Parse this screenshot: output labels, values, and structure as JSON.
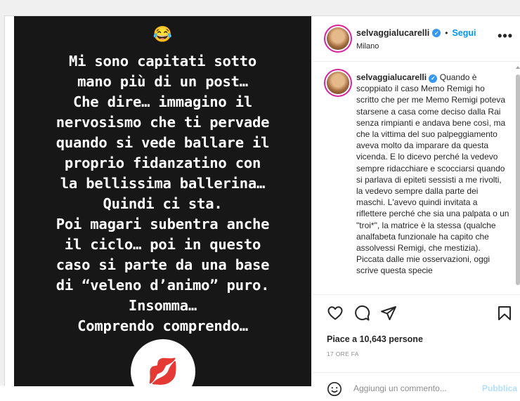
{
  "post": {
    "story": {
      "top_emoji": "😂",
      "lines": [
        "Mi sono capitati sotto",
        "mano più di un post…",
        "Che dire… immagino il",
        "nervosismo che ti pervade",
        "quando si vede ballare il",
        "proprio fidanzatino con",
        "la bellissima ballerina…",
        "Quindi ci sta.",
        "Poi magari subentra anche",
        "il ciclo… poi in questo",
        "caso si parte da una base",
        "di “veleno d’animo” puro.",
        "Insomma…",
        "Comprendo comprendo…"
      ],
      "sticker_emoji": "💋"
    },
    "header": {
      "username": "selvaggialucarelli",
      "verified_icon": "verified-badge-icon",
      "separator": "•",
      "follow_label": "Segui",
      "location": "Milano",
      "more_label": "•••"
    },
    "caption": {
      "username": "selvaggialucarelli",
      "text": "Quando è scoppiato il caso Memo Remigi ho scritto che per me Memo Remigi poteva starsene a casa come deciso dalla Rai senza rimpianti e andava bene così, ma che la vittima del suo palpeggiamento aveva molto da imparare da questa vicenda. E lo dicevo perché la vedevo sempre ridacchiare e scocciarsi quando si parlava di epiteti sessisti a me rivolti, la vedevo sempre dalla parte dei maschi. L'avevo quindi invitata a riflettere perché che sia una palpata o un \"troi*\", la matrice è la stessa (qualche analfabeta funzionale ha capito che assolvessi Remigi, che mestizia). Piccata dalle mie osservazioni, oggi scrive questa specie"
    },
    "actions": {
      "like_icon": "heart-icon",
      "comment_icon": "comment-icon",
      "share_icon": "share-icon",
      "save_icon": "bookmark-icon",
      "likes_text": "Piace a 10,643 persone",
      "time_text": "17 ORE FA"
    },
    "comment_box": {
      "emoji_icon": "smiley-icon",
      "placeholder": "Aggiungi un commento...",
      "publish_label": "Pubblica"
    }
  }
}
